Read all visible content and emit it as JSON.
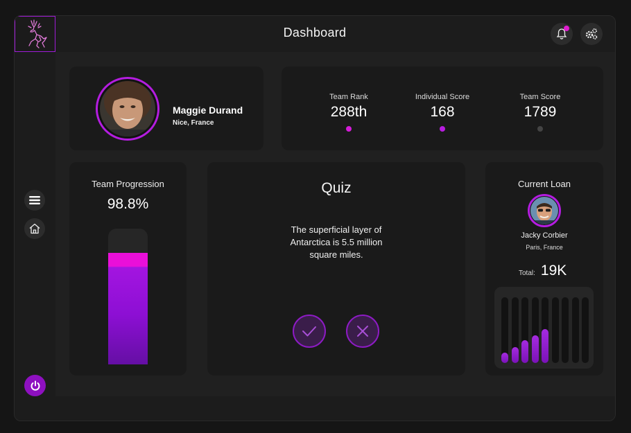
{
  "header": {
    "title": "Dashboard"
  },
  "colors": {
    "accent": "#c81cd8",
    "purple": "#9b1fdc",
    "card": "#1a1a1a",
    "background": "#202020"
  },
  "icons": {
    "logo": "deer-logo-icon",
    "notifications": "bell-icon",
    "settings": "gears-icon",
    "menu": "menu-icon",
    "home": "home-icon",
    "power": "power-icon"
  },
  "profile": {
    "name": "Maggie Durand",
    "location": "Nice, France"
  },
  "stats": [
    {
      "label": "Team Rank",
      "value": "288th",
      "dot_color": "#d41cd8"
    },
    {
      "label": "Individual Score",
      "value": "168",
      "dot_color": "#b81de0"
    },
    {
      "label": "Team Score",
      "value": "1789",
      "dot_color": "#444444"
    }
  ],
  "progression": {
    "title": "Team Progression",
    "value": "98.8%",
    "fill_fraction": 0.82
  },
  "quiz": {
    "title": "Quiz",
    "question": "The superficial layer of Antarctica is 5.5 million square miles."
  },
  "loan": {
    "title": "Current Loan",
    "name": "Jacky Corbier",
    "location": "Paris, France",
    "total_label": "Total:",
    "total_value": "19K",
    "bar_levels": [
      0.16,
      0.24,
      0.35,
      0.42,
      0.52,
      0,
      0,
      0,
      0
    ]
  }
}
